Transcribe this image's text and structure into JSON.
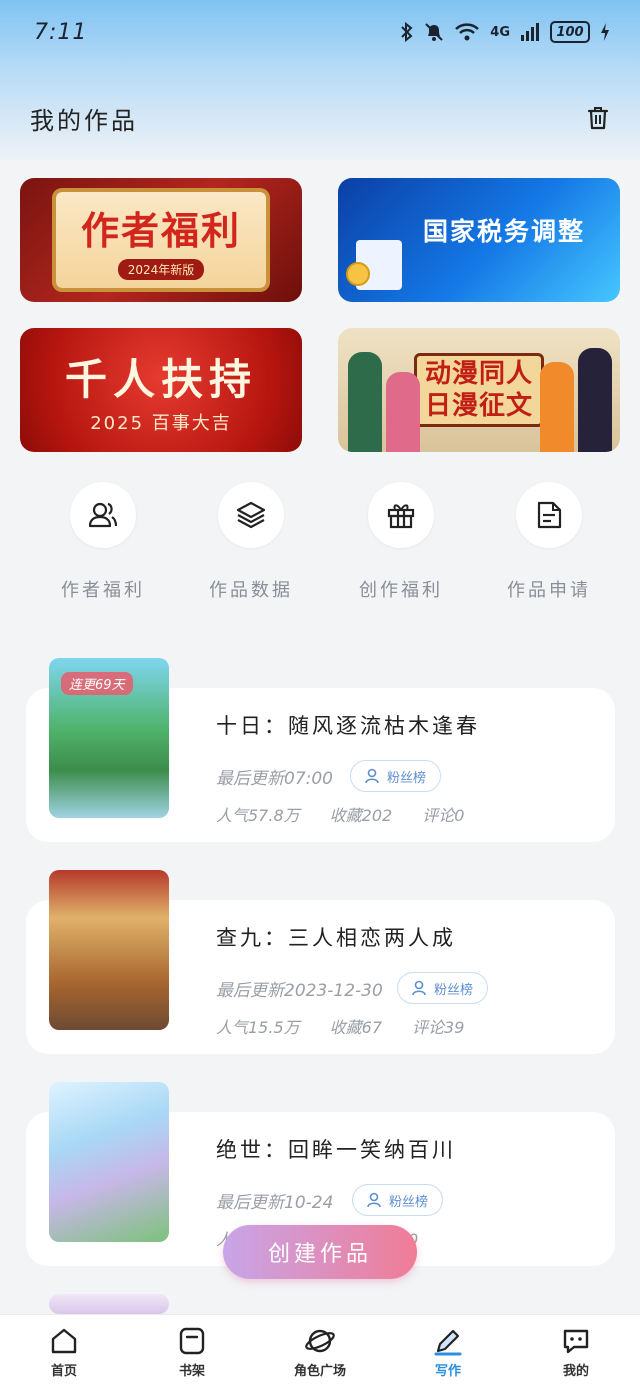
{
  "status_bar": {
    "time": "7:11",
    "battery": "100",
    "network": "4G"
  },
  "header": {
    "title": "我的作品"
  },
  "banners": [
    {
      "main": "作者福利",
      "sub": "2024年新版"
    },
    {
      "main": "国家税务调整"
    },
    {
      "main": "千人扶持",
      "sub": "2025 百事大吉"
    },
    {
      "main_line1": "动漫同人",
      "main_line2": "日漫征文"
    }
  ],
  "quick_actions": [
    {
      "label": "作者福利",
      "icon": "users-icon"
    },
    {
      "label": "作品数据",
      "icon": "layers-icon"
    },
    {
      "label": "创作福利",
      "icon": "gift-icon"
    },
    {
      "label": "作品申请",
      "icon": "document-icon"
    }
  ],
  "works": [
    {
      "title": "十日：随风逐流枯木逢春",
      "update": "最后更新07:00",
      "fans": "粉丝榜",
      "popularity": "人气57.8万",
      "favorites": "收藏202",
      "comments": "评论0",
      "badge": "连更69天"
    },
    {
      "title": "查九：三人相恋两人成",
      "update": "最后更新2023-12-30",
      "fans": "粉丝榜",
      "popularity": "人气15.5万",
      "favorites": "收藏67",
      "comments": "评论39"
    },
    {
      "title": "绝世：回眸一笑纳百川",
      "update": "最后更新10-24",
      "fans": "粉丝榜",
      "popularity": "人",
      "favorites": "",
      "comments": "论0"
    }
  ],
  "create_button": "创建作品",
  "tabs": [
    {
      "label": "首页",
      "icon": "home-icon"
    },
    {
      "label": "书架",
      "icon": "bookshelf-icon"
    },
    {
      "label": "角色广场",
      "icon": "planet-icon"
    },
    {
      "label": "写作",
      "icon": "pen-icon",
      "active": true
    },
    {
      "label": "我的",
      "icon": "chat-icon"
    }
  ],
  "colors": {
    "accent": "#2b8fe0",
    "create_start": "#c8a5e8",
    "create_end": "#f07c96",
    "badge": "#e65f6e"
  }
}
